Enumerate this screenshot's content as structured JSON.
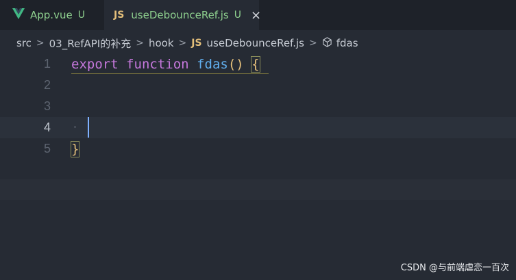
{
  "tabs": [
    {
      "name": "App.vue",
      "status": "U"
    },
    {
      "name": "useDebounceRef.js",
      "status": "U",
      "icon_text": "JS",
      "close": "×"
    }
  ],
  "breadcrumb": {
    "parts": [
      "src",
      "03_RefAPI的补充",
      "hook",
      "useDebounceRef.js",
      "fdas"
    ],
    "js_icon_text": "JS",
    "separator": ">"
  },
  "editor": {
    "line_numbers": [
      "1",
      "2",
      "3",
      "4",
      "5"
    ],
    "code": {
      "keyword_export": "export",
      "keyword_function": "function",
      "function_name": "fdas",
      "parens": "()",
      "open_brace": "{",
      "close_brace": "}"
    }
  },
  "watermark": "CSDN @与前端虐恋一百次",
  "colors": {
    "keyword": "#c678dd",
    "function": "#61afef",
    "bracket": "#e5c07b",
    "tab_text": "#8fd18f"
  }
}
